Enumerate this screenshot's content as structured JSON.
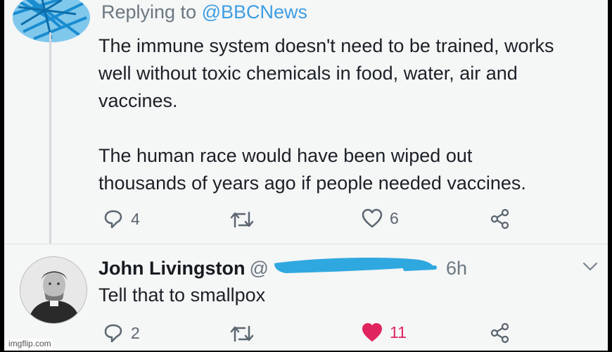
{
  "tweet1": {
    "replying_prefix": "Replying to ",
    "replying_handle": "@BBCNews",
    "text": "The immune system doesn't need to be trained, works\nwell without toxic chemicals in food, water, air and\nvaccines.\n\nThe human race would have been wiped out\nthousands of years ago if people needed vaccines.",
    "reply_count": "4",
    "like_count": "6"
  },
  "tweet2": {
    "name": "John Livingston",
    "handle_visible": "@",
    "time": "6h",
    "text": "Tell that to smallpox",
    "reply_count": "2",
    "like_count": "11",
    "liked": true
  },
  "colors": {
    "accent": "#3e9ee4",
    "like_red": "#e0245e",
    "redaction": "#2fa8e0"
  },
  "watermark": "imgflip.com",
  "icons": [
    "reply-icon",
    "retweet-icon",
    "like-icon",
    "share-icon",
    "chevron-down-icon"
  ]
}
